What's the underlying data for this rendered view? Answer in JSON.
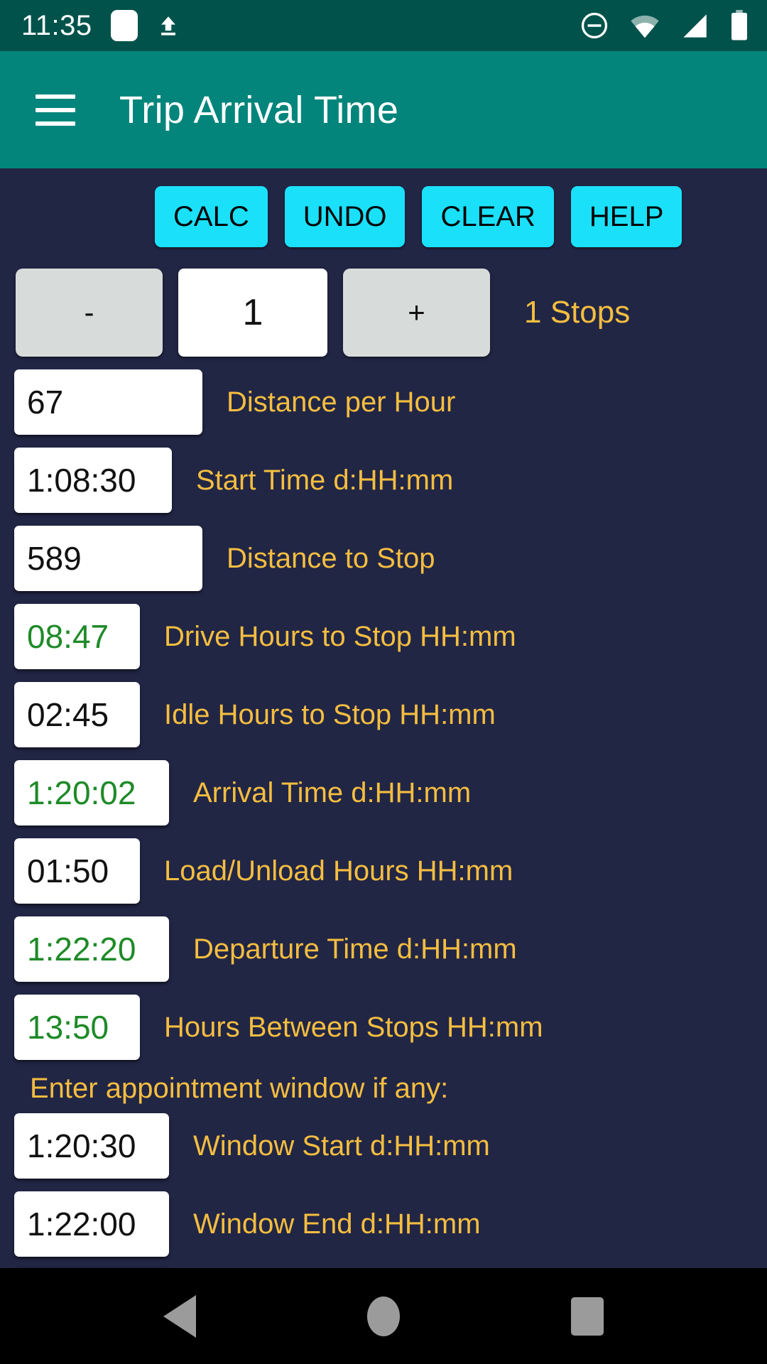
{
  "status_bar": {
    "clock": "11:35",
    "icons": [
      "notification-square-icon",
      "upload-icon",
      "do-not-disturb-icon",
      "wifi-icon",
      "cell-signal-icon",
      "battery-icon"
    ]
  },
  "app_bar": {
    "menu_icon": "hamburger-menu-icon",
    "title": "Trip Arrival Time"
  },
  "toolbar": {
    "calc_label": "CALC",
    "undo_label": "UNDO",
    "clear_label": "CLEAR",
    "help_label": "HELP"
  },
  "stepper": {
    "decrement_label": "-",
    "value": "1",
    "increment_label": "+",
    "stops_label": "1 Stops"
  },
  "fields": [
    {
      "value": "67",
      "label": "Distance per Hour",
      "computed": false,
      "width": "w-num"
    },
    {
      "value": "1:08:30",
      "label": "Start Time d:HH:mm",
      "computed": false,
      "width": "w-time"
    },
    {
      "value": "589",
      "label": "Distance to Stop",
      "computed": false,
      "width": "w-num"
    },
    {
      "value": "08:47",
      "label": "Drive Hours to Stop HH:mm",
      "computed": true,
      "width": "w-day"
    },
    {
      "value": "02:45",
      "label": "Idle Hours to Stop HH:mm",
      "computed": false,
      "width": "w-day"
    },
    {
      "value": "1:20:02",
      "label": "Arrival Time d:HH:mm",
      "computed": true,
      "width": "w-dayl"
    },
    {
      "value": "01:50",
      "label": "Load/Unload Hours HH:mm",
      "computed": false,
      "width": "w-day"
    },
    {
      "value": "1:22:20",
      "label": "Departure Time d:HH:mm",
      "computed": true,
      "width": "w-dayl"
    },
    {
      "value": "13:50",
      "label": "Hours Between Stops HH:mm",
      "computed": true,
      "width": "w-day"
    }
  ],
  "appointment": {
    "note": "Enter appointment window if any:",
    "fields": [
      {
        "value": "1:20:30",
        "label": "Window Start d:HH:mm",
        "computed": false,
        "width": "w-dayl"
      },
      {
        "value": "1:22:00",
        "label": "Window End d:HH:mm",
        "computed": false,
        "width": "w-dayl"
      }
    ]
  },
  "nav_bar": {
    "back": "back-triangle-icon",
    "home": "home-circle-icon",
    "recents": "recents-square-icon"
  },
  "colors": {
    "statusbar_bg": "#00524B",
    "appbar_bg": "#04857B",
    "page_bg": "#222645",
    "button_cyan": "#1BE0FA",
    "label_amber": "#F5BE40",
    "computed_green": "#1E8A28",
    "stepper_gray": "#D7DBDA"
  }
}
